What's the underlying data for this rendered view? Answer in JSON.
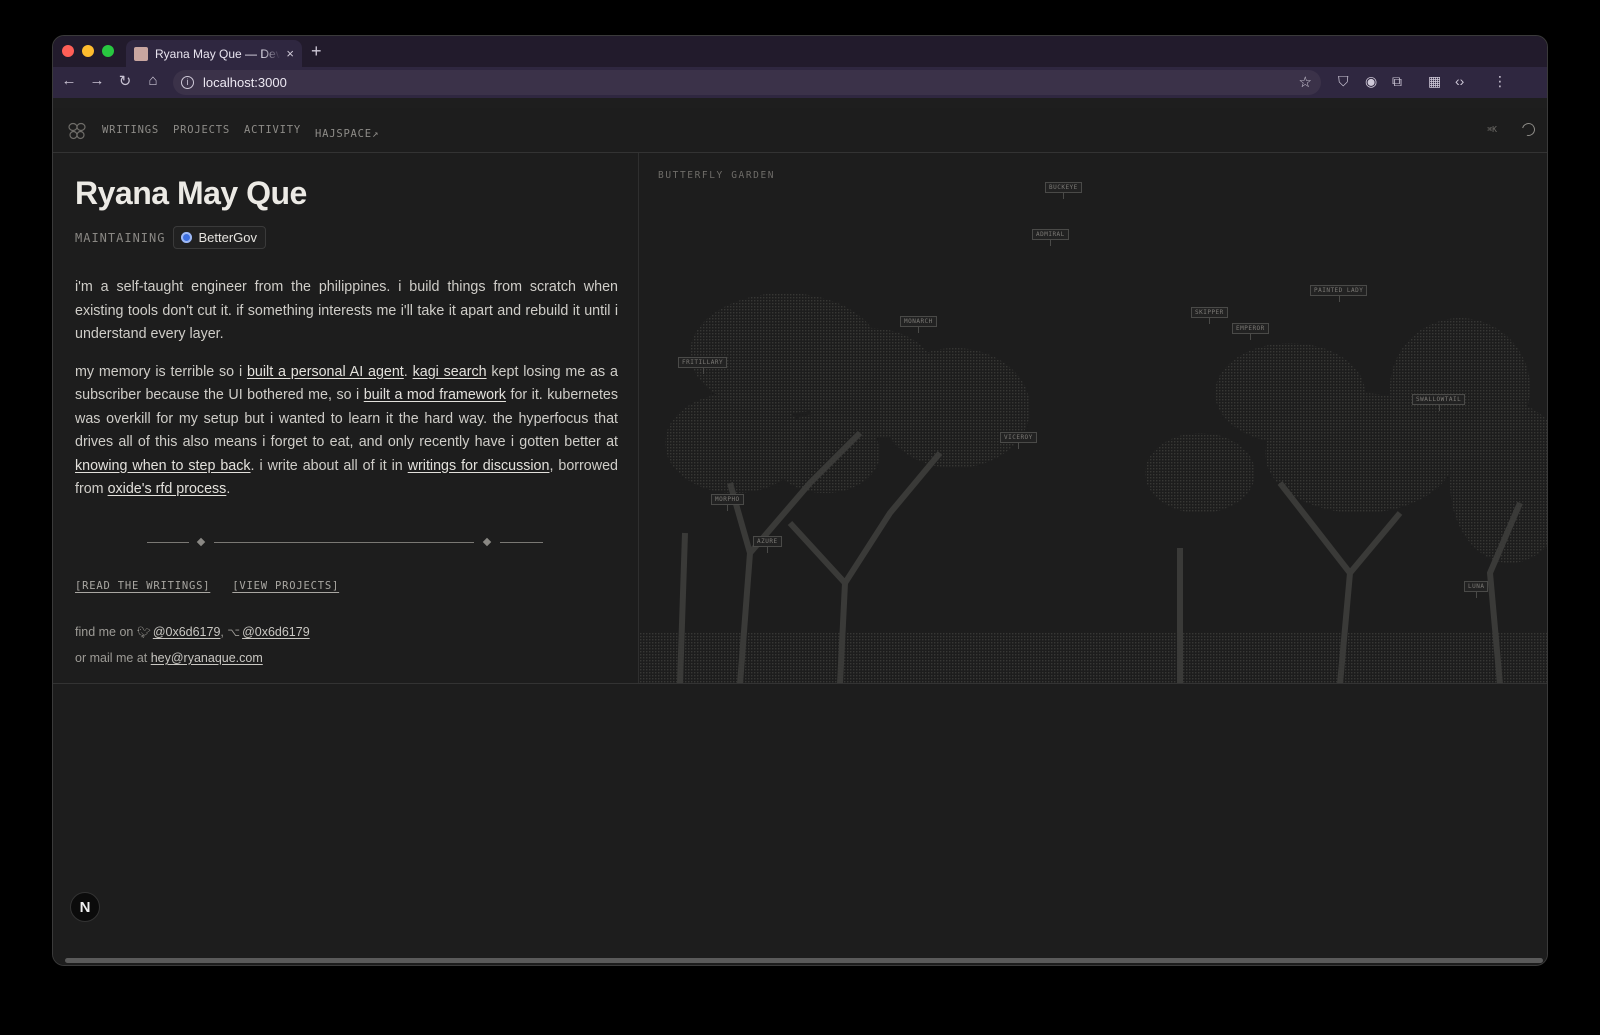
{
  "browser": {
    "tab_title": "Ryana May Que — Developer",
    "url": "localhost:3000",
    "new_tab": "+",
    "tab_close": "×"
  },
  "site_nav": {
    "links": [
      "WRITINGS",
      "PROJECTS",
      "ACTIVITY",
      "HAJSPACE"
    ],
    "shortcut": "⌘K"
  },
  "hero": {
    "name": "Ryana May Que",
    "maintaining_label": "MAINTAINING",
    "maintaining_project": "BetterGov"
  },
  "bio": {
    "p1": "i'm a self-taught engineer from the philippines. i build things from scratch when existing tools don't cut it. if something interests me i'll take it apart and rebuild it until i understand every layer.",
    "p2_a": "my memory is terrible so i ",
    "link_agent": "built a personal AI agent",
    "p2_b": ". ",
    "link_kagi": "kagi search",
    "p2_c": " kept losing me as a subscriber because the UI bothered me, so i ",
    "link_mod": "built a mod framework",
    "p2_d": " for it. kubernetes was overkill for my setup but i wanted to learn it the hard way. the hyperfocus that drives all of this also means i forget to eat, and only recently have i gotten better at ",
    "link_step": "knowing when to step back",
    "p2_e": ". i write about all of it in ",
    "link_writings": "writings for discussion",
    "p2_f": ", borrowed from ",
    "link_rfd": "oxide's rfd process",
    "p2_g": "."
  },
  "cta": {
    "read": "[READ THE WRITINGS]",
    "projects": "[VIEW PROJECTS]"
  },
  "contact": {
    "find_prefix": "find me on ",
    "twitter": "@0x6d6179",
    "sep": ", ",
    "github": "@0x6d6179",
    "mail_prefix": "or mail me at ",
    "email": "hey@ryanaque.com"
  },
  "garden": {
    "label": "BUTTERFLY GARDEN",
    "butterflies": [
      "BUCKEYE",
      "ADMIRAL",
      "PAINTED LADY",
      "SKIPPER",
      "EMPEROR",
      "MONARCH",
      "FRITILLARY",
      "SWALLOWTAIL",
      "VICEROY",
      "MORPHO",
      "AZURE",
      "LUNA"
    ]
  },
  "badge": {
    "next": "N"
  },
  "colors": {
    "accent_blue": "#3d6fe0",
    "bg": "#1d1d1d",
    "chrome": "#2f2740"
  }
}
